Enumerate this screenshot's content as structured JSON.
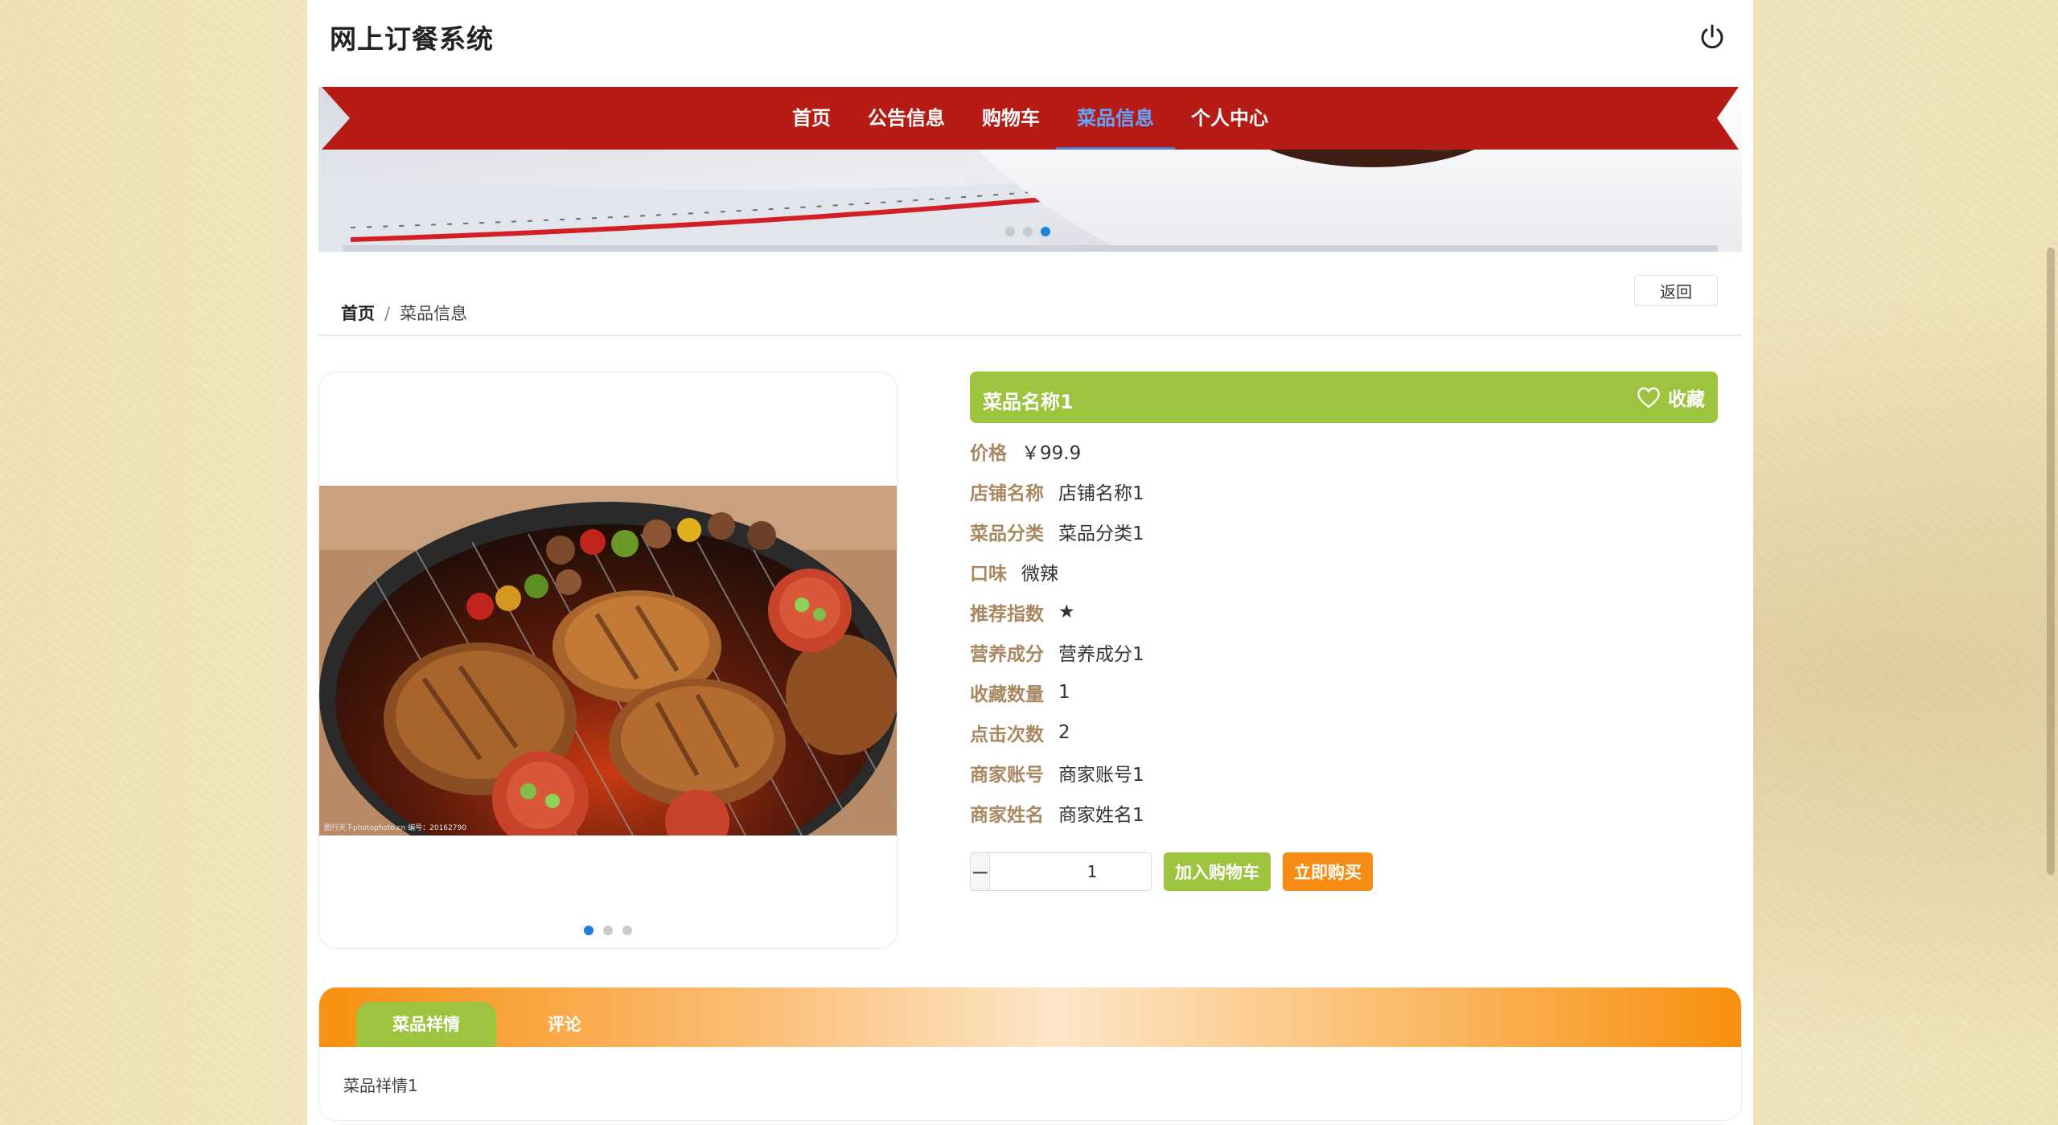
{
  "header": {
    "site_title": "网上订餐系统",
    "logout_icon": "power-icon"
  },
  "nav": {
    "items": [
      "首页",
      "公告信息",
      "购物车",
      "菜品信息",
      "个人中心"
    ],
    "active_index": 3
  },
  "banner": {
    "slide_count": 3,
    "active_slide": 3
  },
  "breadcrumb": {
    "home": "首页",
    "separator": "/",
    "current": "菜品信息"
  },
  "back_button": "返回",
  "gallery": {
    "image_watermark": "图行天下photophoto.cn 编号：20162790",
    "slide_count": 3,
    "active_slide": 1
  },
  "product": {
    "name": "菜品名称1",
    "favorite_label": "收藏",
    "favorite_icon": "heart-icon",
    "fields": [
      {
        "label": "价格",
        "value": "￥99.9"
      },
      {
        "label": "店铺名称",
        "value": "店铺名称1"
      },
      {
        "label": "菜品分类",
        "value": "菜品分类1"
      },
      {
        "label": "口味",
        "value": "微辣"
      },
      {
        "label": "推荐指数",
        "value": "★"
      },
      {
        "label": "营养成分",
        "value": "营养成分1"
      },
      {
        "label": "收藏数量",
        "value": "1"
      },
      {
        "label": "点击次数",
        "value": "2"
      },
      {
        "label": "商家账号",
        "value": "商家账号1"
      },
      {
        "label": "商家姓名",
        "value": "商家姓名1"
      }
    ]
  },
  "purchase": {
    "minus": "−",
    "quantity": "1",
    "plus": "+",
    "add_to_cart": "加入购物车",
    "buy_now": "立即购买"
  },
  "tabs": {
    "items": [
      "菜品祥情",
      "评论"
    ],
    "active_index": 0,
    "content": "菜品祥情1"
  },
  "colors": {
    "nav_red": "#b71b16",
    "green": "#9cc43f",
    "orange": "#f68c15",
    "label_brown": "#a88860",
    "active_blue": "#5ea8ff"
  }
}
